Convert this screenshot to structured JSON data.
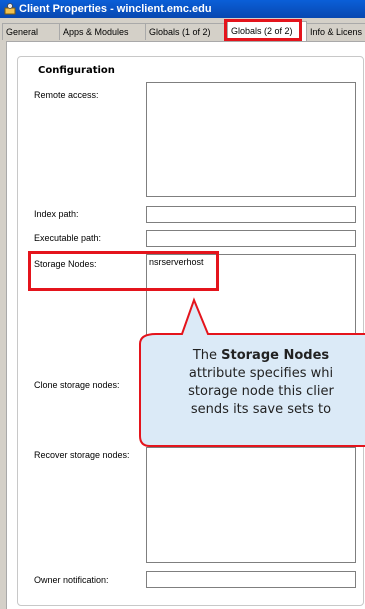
{
  "window": {
    "title": "Client Properties - winclient.emc.edu",
    "icon": "client-properties-icon"
  },
  "tabs": [
    {
      "label": "General"
    },
    {
      "label": "Apps & Modules"
    },
    {
      "label": "Globals (1 of 2)"
    },
    {
      "label": "Globals (2 of 2)",
      "active": true
    },
    {
      "label": "Info & Licens"
    }
  ],
  "configuration": {
    "legend": "Configuration",
    "remote_access": {
      "label": "Remote access:",
      "value": ""
    },
    "index_path": {
      "label": "Index path:",
      "value": ""
    },
    "executable_path": {
      "label": "Executable path:",
      "value": ""
    },
    "storage_nodes": {
      "label": "Storage Nodes:",
      "value": "nsrserverhost"
    },
    "clone_storage_nodes": {
      "label": "Clone storage nodes:",
      "value": ""
    },
    "recover_storage_nodes": {
      "label": "Recover storage nodes:",
      "value": ""
    },
    "owner_notification": {
      "label": "Owner notification:",
      "value": ""
    }
  },
  "callout": {
    "line1_pre": "The ",
    "line1_bold": "Storage Nodes",
    "line2": "attribute specifies whi",
    "line3": "storage node this clier",
    "line4": "sends its save sets to"
  },
  "colors": {
    "highlight": "#e4141c",
    "callout_fill": "#dbeaf7",
    "callout_border": "#e4141c",
    "titlebar": "#0a5fd8"
  }
}
